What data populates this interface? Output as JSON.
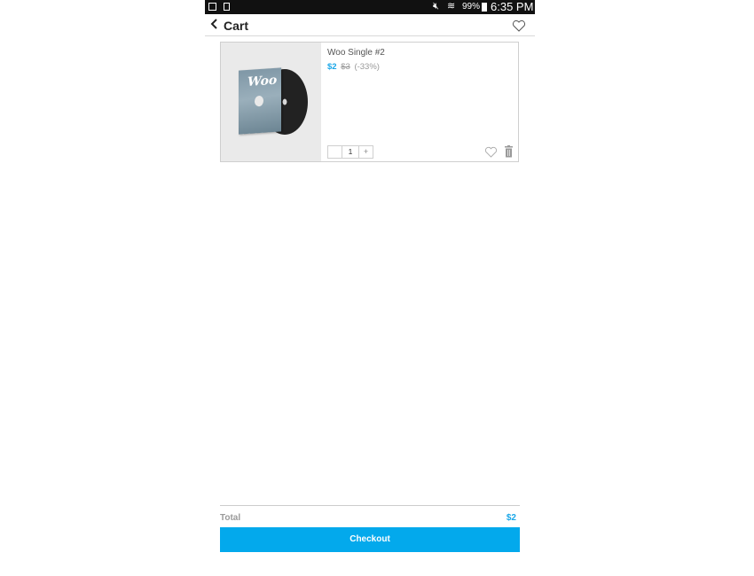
{
  "status_bar": {
    "battery": "99%",
    "time": "6:35 PM",
    "icons": [
      "gallery-icon",
      "sim-icon",
      "mute-icon",
      "wifi-icon",
      "battery-icon"
    ]
  },
  "header": {
    "title": "Cart",
    "icons": [
      "back-icon",
      "heart-icon"
    ]
  },
  "cart": {
    "items": [
      {
        "name": "Woo Single #2",
        "price": "$2",
        "original_price": "$3",
        "discount": "(-33%)",
        "quantity": "1",
        "minus_label": "",
        "plus_label": "+",
        "image_logo": "Woo"
      }
    ]
  },
  "footer": {
    "total_label": "Total",
    "total_value": "$2",
    "checkout_label": "Checkout"
  },
  "colors": {
    "accent": "#03a9ec",
    "price": "#1aa7e8"
  }
}
